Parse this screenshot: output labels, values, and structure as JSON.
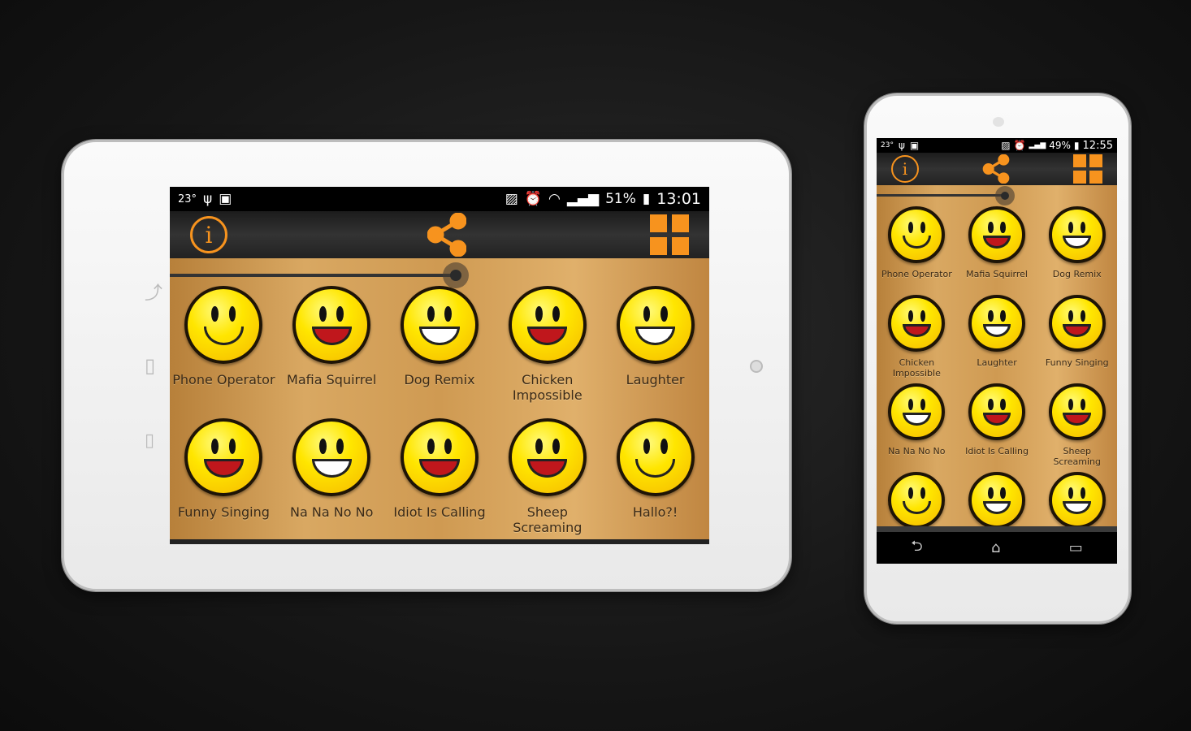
{
  "tablet": {
    "status": {
      "temperature": "23°",
      "battery": "51%",
      "time": "13:01"
    },
    "items": [
      {
        "label": "Phone Operator",
        "mouth": "smile"
      },
      {
        "label": "Mafia Squirrel",
        "mouth": "open"
      },
      {
        "label": "Dog Remix",
        "mouth": "teeth"
      },
      {
        "label": "Chicken Impossible",
        "mouth": "open"
      },
      {
        "label": "Laughter",
        "mouth": "teeth"
      },
      {
        "label": "Funny Singing",
        "mouth": "open"
      },
      {
        "label": "Na Na No No",
        "mouth": "teeth"
      },
      {
        "label": "Idiot Is Calling",
        "mouth": "open"
      },
      {
        "label": "Sheep Screaming",
        "mouth": "open"
      },
      {
        "label": "Hallo?!",
        "mouth": "smile"
      }
    ]
  },
  "phone": {
    "status": {
      "temperature": "23°",
      "battery": "49%",
      "time": "12:55"
    },
    "items": [
      {
        "label": "Phone Operator",
        "mouth": "smile"
      },
      {
        "label": "Mafia Squirrel",
        "mouth": "open"
      },
      {
        "label": "Dog Remix",
        "mouth": "teeth"
      },
      {
        "label": "Chicken Impossible",
        "mouth": "open"
      },
      {
        "label": "Laughter",
        "mouth": "teeth"
      },
      {
        "label": "Funny Singing",
        "mouth": "open"
      },
      {
        "label": "Na Na No No",
        "mouth": "teeth"
      },
      {
        "label": "Idiot Is Calling",
        "mouth": "open"
      },
      {
        "label": "Sheep Screaming",
        "mouth": "open"
      },
      {
        "label": "",
        "mouth": "smile"
      },
      {
        "label": "",
        "mouth": "teeth"
      },
      {
        "label": "",
        "mouth": "teeth"
      }
    ]
  },
  "icons": {
    "info": "i",
    "accent": "#f7931e"
  }
}
